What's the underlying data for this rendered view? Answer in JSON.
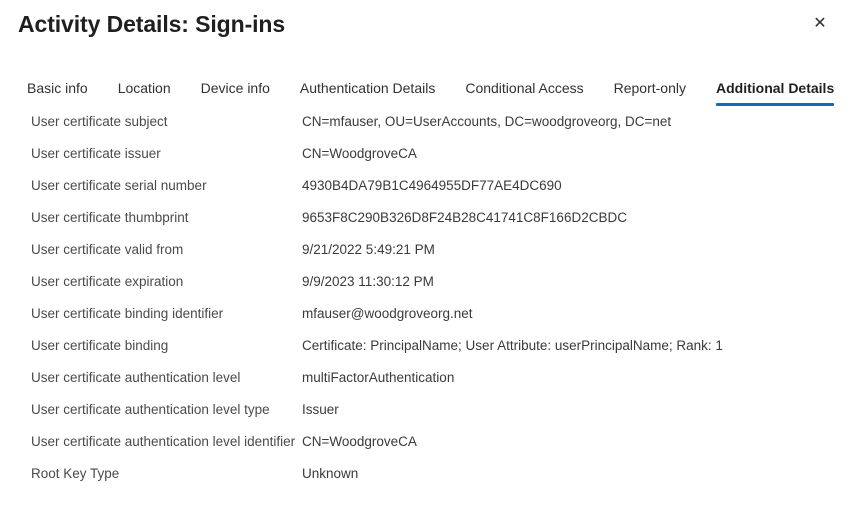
{
  "header": {
    "title": "Activity Details: Sign-ins",
    "close_label": "✕",
    "close_icon": "close-icon"
  },
  "tabs": [
    {
      "label": "Basic info",
      "active": false
    },
    {
      "label": "Location",
      "active": false
    },
    {
      "label": "Device info",
      "active": false
    },
    {
      "label": "Authentication Details",
      "active": false
    },
    {
      "label": "Conditional Access",
      "active": false
    },
    {
      "label": "Report-only",
      "active": false
    },
    {
      "label": "Additional Details",
      "active": true
    }
  ],
  "details": [
    {
      "label": "User certificate subject",
      "value": "CN=mfauser, OU=UserAccounts, DC=woodgroveorg, DC=net"
    },
    {
      "label": "User certificate issuer",
      "value": "CN=WoodgroveCA"
    },
    {
      "label": "User certificate serial number",
      "value": "4930B4DA79B1C4964955DF77AE4DC690"
    },
    {
      "label": "User certificate thumbprint",
      "value": "9653F8C290B326D8F24B28C41741C8F166D2CBDC"
    },
    {
      "label": "User certificate valid from",
      "value": "9/21/2022 5:49:21 PM"
    },
    {
      "label": "User certificate expiration",
      "value": "9/9/2023 11:30:12 PM"
    },
    {
      "label": "User certificate binding identifier",
      "value": "mfauser@woodgroveorg.net"
    },
    {
      "label": "User certificate binding",
      "value": "Certificate: PrincipalName; User Attribute: userPrincipalName; Rank: 1"
    },
    {
      "label": "User certificate authentication level",
      "value": "multiFactorAuthentication"
    },
    {
      "label": "User certificate authentication level type",
      "value": "Issuer"
    },
    {
      "label": "User certificate authentication level identifier",
      "value": "CN=WoodgroveCA"
    },
    {
      "label": "Root Key Type",
      "value": "Unknown"
    }
  ],
  "colors": {
    "accent": "#0f6cbd",
    "text_primary": "#201f1e",
    "text_secondary": "#4b4a48",
    "background": "#ffffff"
  }
}
